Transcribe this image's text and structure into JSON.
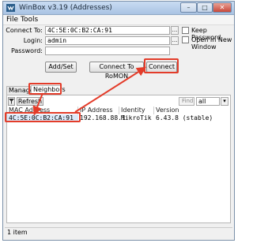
{
  "window": {
    "title": "WinBox v3.19 (Addresses)",
    "min_glyph": "–",
    "max_glyph": "□",
    "close_glyph": "✕"
  },
  "menu": [
    "File",
    "Tools"
  ],
  "form": {
    "connect_to_label": "Connect To:",
    "connect_to_value": "4C:5E:0C:B2:CA:91",
    "login_label": "Login:",
    "login_value": "admin",
    "password_label": "Password:",
    "password_value": "",
    "ellipsis": "...",
    "keep_password_label": "Keep Password",
    "open_new_window_label": "Open In New Window"
  },
  "buttons": {
    "add_set": "Add/Set",
    "connect_romon": "Connect To RoMON",
    "connect": "Connect"
  },
  "tabs": [
    "Managed",
    "Neighbors"
  ],
  "toolbar": {
    "refresh": "Refresh",
    "find": "Find",
    "filter_value": "all"
  },
  "table": {
    "columns": [
      "MAC Address",
      "IP Address",
      "Identity",
      "Version"
    ],
    "rows": [
      {
        "mac": "4C:5E:0C:B2:CA:91",
        "ip": "192.168.88.1",
        "identity": "MikroTik",
        "version": "6.43.8 (stable)"
      }
    ]
  },
  "status": {
    "text": "1 item"
  },
  "colors": {
    "annotation": "#e33c2a",
    "selection": "#dce9f9"
  }
}
